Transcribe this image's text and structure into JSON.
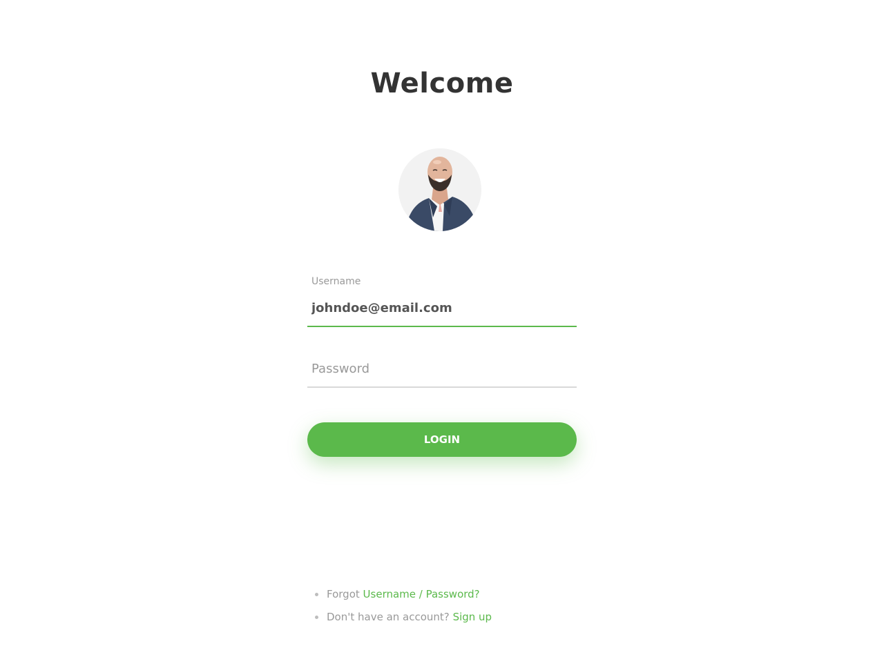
{
  "header": {
    "title": "Welcome"
  },
  "avatar": {
    "alt": "User avatar"
  },
  "form": {
    "username": {
      "label": "Username",
      "value": "johndoe@email.com"
    },
    "password": {
      "placeholder": "Password",
      "value": ""
    },
    "login_label": "LOGIN"
  },
  "links": {
    "forgot_prefix": "Forgot",
    "forgot_link": "Username / Password?",
    "signup_prefix": "Don't have an account?",
    "signup_link": "Sign up"
  },
  "colors": {
    "accent": "#5bb94b",
    "title_text": "#333333",
    "muted_text": "#999999"
  }
}
